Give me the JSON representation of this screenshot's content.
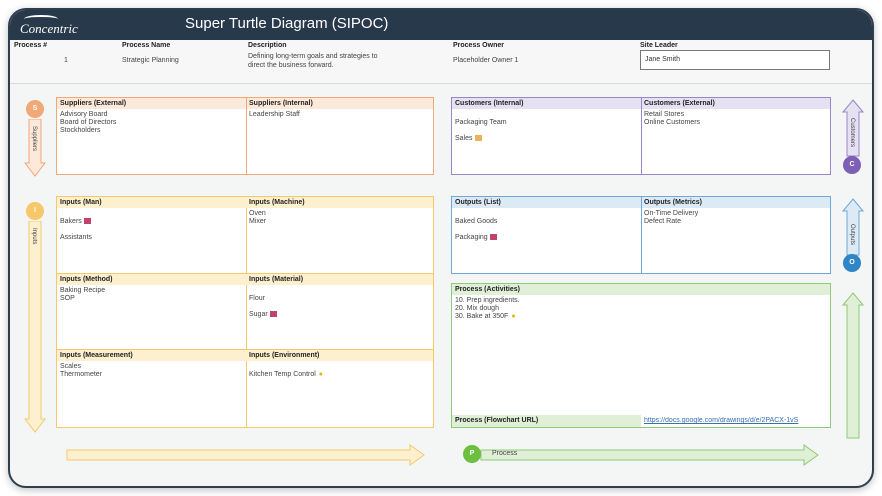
{
  "header": {
    "logo_text": "Concentric",
    "title": "Super Turtle Diagram (SIPOC)"
  },
  "info": {
    "process_num_label": "Process #",
    "process_num": "1",
    "process_name_label": "Process Name",
    "process_name": "Strategic Planning",
    "description_label": "Description",
    "description": "Defining long-term goals and strategies to\ndirect the business forward.",
    "owner_label": "Process Owner",
    "owner": "Placeholder Owner 1",
    "site_leader_label": "Site Leader",
    "site_leader": "Jane Smith"
  },
  "side": {
    "s_letter": "S",
    "s_label": "Suppliers",
    "i_letter": "I",
    "i_label": "Inputs",
    "c_letter": "C",
    "c_label": "Customers",
    "o_letter": "O",
    "o_label": "Outputs",
    "p_letter": "P",
    "p_label": "Process"
  },
  "suppliers": {
    "ext_title": "Suppliers (External)",
    "ext_items": "Advisory Board\nBoard of Directors\nStockholders",
    "int_title": "Suppliers (Internal)",
    "int_items": "Leadership Staff"
  },
  "customers": {
    "int_title": "Customers (Internal)",
    "int_item1": "Packaging Team",
    "int_item2": "Sales",
    "ext_title": "Customers (External)",
    "ext_items": "Retail Stores\nOnline Customers"
  },
  "inputs": {
    "man_title": "Inputs (Man)",
    "man_item1": "Bakers",
    "man_item2": "Assistants",
    "machine_title": "Inputs (Machine)",
    "machine_items": "Oven\nMixer",
    "method_title": "Inputs (Method)",
    "method_items": "Baking Recipe\nSOP",
    "material_title": "Inputs (Material)",
    "material_item1": "Flour",
    "material_item2": "Sugar",
    "measurement_title": "Inputs (Measurement)",
    "measurement_items": "Scales\nThermometer",
    "environment_title": "Inputs (Environment)",
    "environment_item1": "Kitchen Temp Control"
  },
  "outputs": {
    "list_title": "Outputs (List)",
    "list_item1": "Baked Goods",
    "list_item2": "Packaging",
    "metrics_title": "Outputs (Metrics)",
    "metrics_items": "On-Time Delivery\nDefect Rate"
  },
  "process": {
    "activities_title": "Process (Activities)",
    "activities": "10. Prep ingredients.\n20. Mix dough\n30. Bake at 350F",
    "flowchart_label": "Process (Flowchart URL)",
    "flowchart_url": "https://docs.google.com/drawings/d/e/2PACX-1vS"
  },
  "colors": {
    "supplier": "#f0a877",
    "supplier_bg": "#fde9da",
    "input": "#f6c86a",
    "input_bg": "#fdf0cf",
    "customer": "#9a86c6",
    "customer_bg": "#e6e0f3",
    "output": "#6fa8d6",
    "output_bg": "#dceaf6",
    "process": "#8fc97a",
    "process_bg": "#dff0d6"
  }
}
